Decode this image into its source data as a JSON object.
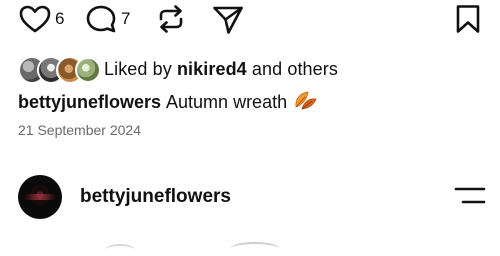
{
  "actions": {
    "likes_count": "6",
    "comments_count": "7"
  },
  "likes": {
    "prefix": "Liked by ",
    "user": "nikired4",
    "suffix": " and others"
  },
  "caption": {
    "username": "bettyjuneflowers",
    "text": "Autumn wreath"
  },
  "post_date": "21 September 2024",
  "next_post": {
    "username": "bettyjuneflowers"
  },
  "icons": {
    "like": "heart-icon",
    "comment": "comment-icon",
    "repost": "repost-icon",
    "share": "send-icon",
    "save": "bookmark-icon",
    "leaf": "autumn-leaf-emoji",
    "menu": "menu-icon"
  },
  "colors": {
    "text": "#111111",
    "muted": "#6b6b6b",
    "leaf": "#e07a1f"
  }
}
